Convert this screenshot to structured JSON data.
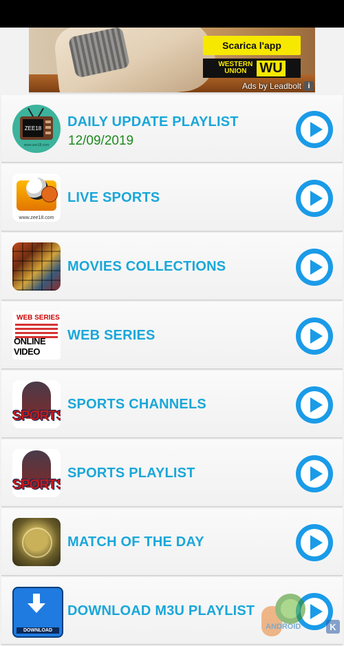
{
  "ad": {
    "cta_label": "Scarica l'app",
    "brand_text": "WESTERN\nUNION",
    "brand_mark": "WU",
    "label": "Ads by Leadbolt",
    "info": "i"
  },
  "items": [
    {
      "title": "DAILY UPDATE PLAYLIST",
      "date": "12/09/2019",
      "icon": "tv-icon",
      "thumb_caption": "ZEE18",
      "thumb_subcaption": "www.zee18.com"
    },
    {
      "title": "LIVE SPORTS",
      "icon": "sports-folder-icon",
      "thumb_caption": "www.zee18.com"
    },
    {
      "title": "MOVIES COLLECTIONS",
      "icon": "movie-posters-icon"
    },
    {
      "title": "WEB SERIES",
      "icon": "web-series-icon",
      "thumb_top": "WEB SERIES",
      "thumb_bottom": "ONLINE VIDEO"
    },
    {
      "title": "SPORTS CHANNELS",
      "icon": "sports-logo-icon",
      "thumb_word": "SPORTS"
    },
    {
      "title": "SPORTS PLAYLIST",
      "icon": "sports-logo-icon",
      "thumb_word": "SPORTS"
    },
    {
      "title": "MATCH OF THE DAY",
      "icon": "match-badge-icon"
    },
    {
      "title": "DOWNLOAD M3U PLAYLIST",
      "icon": "download-icon",
      "thumb_caption": "DOWNLOAD"
    }
  ],
  "watermark": {
    "text": "ANDROID"
  },
  "colors": {
    "title": "#1aa7d9",
    "date": "#1d8a1d",
    "play": "#1a9be8"
  }
}
